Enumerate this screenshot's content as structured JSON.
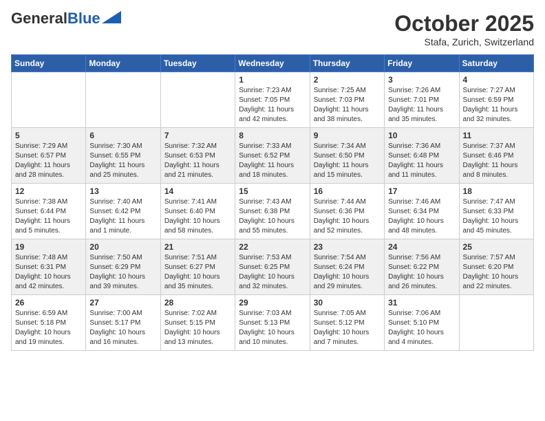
{
  "header": {
    "logo_general": "General",
    "logo_blue": "Blue",
    "month": "October 2025",
    "location": "Stafa, Zurich, Switzerland"
  },
  "days_of_week": [
    "Sunday",
    "Monday",
    "Tuesday",
    "Wednesday",
    "Thursday",
    "Friday",
    "Saturday"
  ],
  "weeks": [
    [
      {
        "day": "",
        "info": ""
      },
      {
        "day": "",
        "info": ""
      },
      {
        "day": "",
        "info": ""
      },
      {
        "day": "1",
        "info": "Sunrise: 7:23 AM\nSunset: 7:05 PM\nDaylight: 11 hours\nand 42 minutes."
      },
      {
        "day": "2",
        "info": "Sunrise: 7:25 AM\nSunset: 7:03 PM\nDaylight: 11 hours\nand 38 minutes."
      },
      {
        "day": "3",
        "info": "Sunrise: 7:26 AM\nSunset: 7:01 PM\nDaylight: 11 hours\nand 35 minutes."
      },
      {
        "day": "4",
        "info": "Sunrise: 7:27 AM\nSunset: 6:59 PM\nDaylight: 11 hours\nand 32 minutes."
      }
    ],
    [
      {
        "day": "5",
        "info": "Sunrise: 7:29 AM\nSunset: 6:57 PM\nDaylight: 11 hours\nand 28 minutes."
      },
      {
        "day": "6",
        "info": "Sunrise: 7:30 AM\nSunset: 6:55 PM\nDaylight: 11 hours\nand 25 minutes."
      },
      {
        "day": "7",
        "info": "Sunrise: 7:32 AM\nSunset: 6:53 PM\nDaylight: 11 hours\nand 21 minutes."
      },
      {
        "day": "8",
        "info": "Sunrise: 7:33 AM\nSunset: 6:52 PM\nDaylight: 11 hours\nand 18 minutes."
      },
      {
        "day": "9",
        "info": "Sunrise: 7:34 AM\nSunset: 6:50 PM\nDaylight: 11 hours\nand 15 minutes."
      },
      {
        "day": "10",
        "info": "Sunrise: 7:36 AM\nSunset: 6:48 PM\nDaylight: 11 hours\nand 11 minutes."
      },
      {
        "day": "11",
        "info": "Sunrise: 7:37 AM\nSunset: 6:46 PM\nDaylight: 11 hours\nand 8 minutes."
      }
    ],
    [
      {
        "day": "12",
        "info": "Sunrise: 7:38 AM\nSunset: 6:44 PM\nDaylight: 11 hours\nand 5 minutes."
      },
      {
        "day": "13",
        "info": "Sunrise: 7:40 AM\nSunset: 6:42 PM\nDaylight: 11 hours\nand 1 minute."
      },
      {
        "day": "14",
        "info": "Sunrise: 7:41 AM\nSunset: 6:40 PM\nDaylight: 10 hours\nand 58 minutes."
      },
      {
        "day": "15",
        "info": "Sunrise: 7:43 AM\nSunset: 6:38 PM\nDaylight: 10 hours\nand 55 minutes."
      },
      {
        "day": "16",
        "info": "Sunrise: 7:44 AM\nSunset: 6:36 PM\nDaylight: 10 hours\nand 52 minutes."
      },
      {
        "day": "17",
        "info": "Sunrise: 7:46 AM\nSunset: 6:34 PM\nDaylight: 10 hours\nand 48 minutes."
      },
      {
        "day": "18",
        "info": "Sunrise: 7:47 AM\nSunset: 6:33 PM\nDaylight: 10 hours\nand 45 minutes."
      }
    ],
    [
      {
        "day": "19",
        "info": "Sunrise: 7:48 AM\nSunset: 6:31 PM\nDaylight: 10 hours\nand 42 minutes."
      },
      {
        "day": "20",
        "info": "Sunrise: 7:50 AM\nSunset: 6:29 PM\nDaylight: 10 hours\nand 39 minutes."
      },
      {
        "day": "21",
        "info": "Sunrise: 7:51 AM\nSunset: 6:27 PM\nDaylight: 10 hours\nand 35 minutes."
      },
      {
        "day": "22",
        "info": "Sunrise: 7:53 AM\nSunset: 6:25 PM\nDaylight: 10 hours\nand 32 minutes."
      },
      {
        "day": "23",
        "info": "Sunrise: 7:54 AM\nSunset: 6:24 PM\nDaylight: 10 hours\nand 29 minutes."
      },
      {
        "day": "24",
        "info": "Sunrise: 7:56 AM\nSunset: 6:22 PM\nDaylight: 10 hours\nand 26 minutes."
      },
      {
        "day": "25",
        "info": "Sunrise: 7:57 AM\nSunset: 6:20 PM\nDaylight: 10 hours\nand 22 minutes."
      }
    ],
    [
      {
        "day": "26",
        "info": "Sunrise: 6:59 AM\nSunset: 5:18 PM\nDaylight: 10 hours\nand 19 minutes."
      },
      {
        "day": "27",
        "info": "Sunrise: 7:00 AM\nSunset: 5:17 PM\nDaylight: 10 hours\nand 16 minutes."
      },
      {
        "day": "28",
        "info": "Sunrise: 7:02 AM\nSunset: 5:15 PM\nDaylight: 10 hours\nand 13 minutes."
      },
      {
        "day": "29",
        "info": "Sunrise: 7:03 AM\nSunset: 5:13 PM\nDaylight: 10 hours\nand 10 minutes."
      },
      {
        "day": "30",
        "info": "Sunrise: 7:05 AM\nSunset: 5:12 PM\nDaylight: 10 hours\nand 7 minutes."
      },
      {
        "day": "31",
        "info": "Sunrise: 7:06 AM\nSunset: 5:10 PM\nDaylight: 10 hours\nand 4 minutes."
      },
      {
        "day": "",
        "info": ""
      }
    ]
  ],
  "row_shading": [
    false,
    true,
    false,
    true,
    false
  ]
}
